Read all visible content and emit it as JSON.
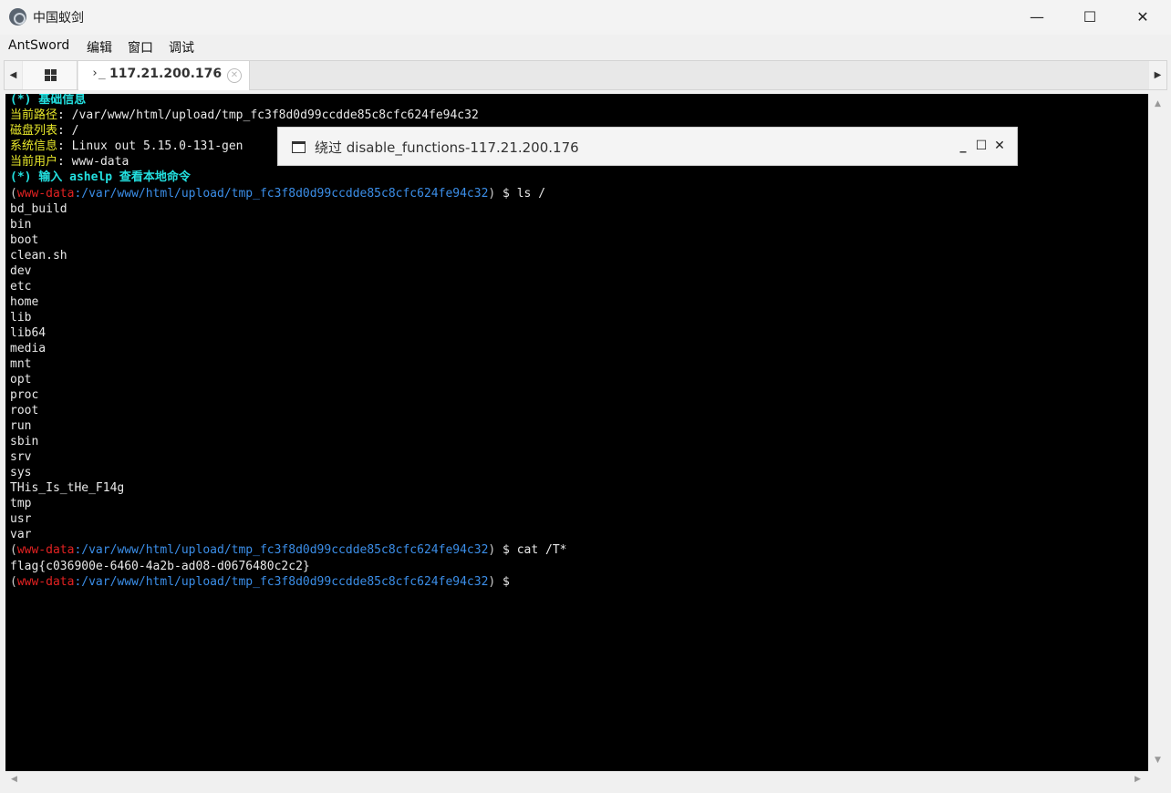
{
  "window": {
    "title": "中国蚁剑",
    "minimize_glyph": "—",
    "maximize_glyph": "☐",
    "close_glyph": "✕"
  },
  "menu": [
    "AntSword",
    "编辑",
    "窗口",
    "调试"
  ],
  "tabs": {
    "left_arrow": "◀",
    "right_arrow": "▶",
    "active": {
      "prompt_glyph": "›_",
      "label": "117.21.200.176",
      "close_glyph": "✕"
    }
  },
  "terminal": {
    "info_header": "(*) 基础信息",
    "info": [
      {
        "label": "当前路径",
        "value": "/var/www/html/upload/tmp_fc3f8d0d99ccdde85c8cfc624fe94c32"
      },
      {
        "label": "磁盘列表",
        "value": "/"
      },
      {
        "label": "系统信息",
        "value": "Linux out 5.15.0-131-gen"
      },
      {
        "label": "当前用户",
        "value": "www-data"
      }
    ],
    "help_hint": "(*) 输入 ashelp 查看本地命令",
    "prompt_user": "www-data",
    "prompt_path": ":/var/www/html/upload/tmp_fc3f8d0d99ccdde85c8cfc624fe94c32",
    "commands": [
      " $ ls /",
      " $ cat /T*",
      " $"
    ],
    "ls_output": [
      "bd_build",
      "bin",
      "boot",
      "clean.sh",
      "dev",
      "etc",
      "home",
      "lib",
      "lib64",
      "media",
      "mnt",
      "opt",
      "proc",
      "root",
      "run",
      "sbin",
      "srv",
      "sys",
      "THis_Is_tHe_F14g",
      "tmp",
      "usr",
      "var"
    ],
    "cat_output": "flag{c036900e-6460-4a2b-ad08-d0676480c2c2}"
  },
  "dialog": {
    "title": "绕过 disable_functions-117.21.200.176",
    "min_glyph": "_",
    "max_glyph": "☐",
    "close_glyph": "✕"
  },
  "colors": {
    "terminal_bg": "#000000",
    "cyan": "#23e0e0",
    "yellow": "#e8e82a",
    "user_red": "#e32222",
    "path_blue": "#3b8ee8"
  }
}
